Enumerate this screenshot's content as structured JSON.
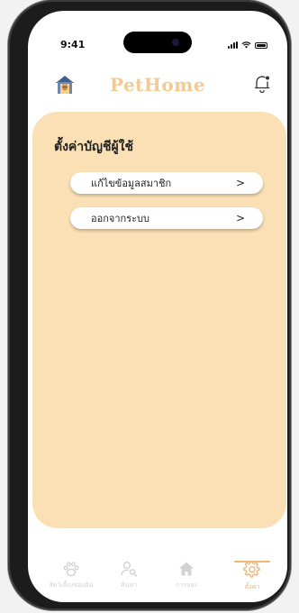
{
  "status_bar": {
    "time": "9:41"
  },
  "header": {
    "brand": "PetHome"
  },
  "settings": {
    "title": "ตั้งค่าบัญชีผู้ใช้",
    "items": [
      {
        "label": "แก้ไขข้อมูลสมาชิก",
        "chevron": ">"
      },
      {
        "label": "ออกจากระบบ",
        "chevron": ">"
      }
    ]
  },
  "tabs": [
    {
      "label": "สัตว์เลี้ยงของฉัน",
      "icon": "paw-icon"
    },
    {
      "label": "ค้นหา",
      "icon": "search-user-icon"
    },
    {
      "label": "การจอง",
      "icon": "home-icon"
    },
    {
      "label": "ตั้งค่า",
      "icon": "gear-icon",
      "active": true
    }
  ],
  "colors": {
    "brand": "#f5c98f",
    "card_bg": "#fae0b4",
    "active_tab": "#f0b572",
    "inactive_tab": "#d2d2d2"
  }
}
